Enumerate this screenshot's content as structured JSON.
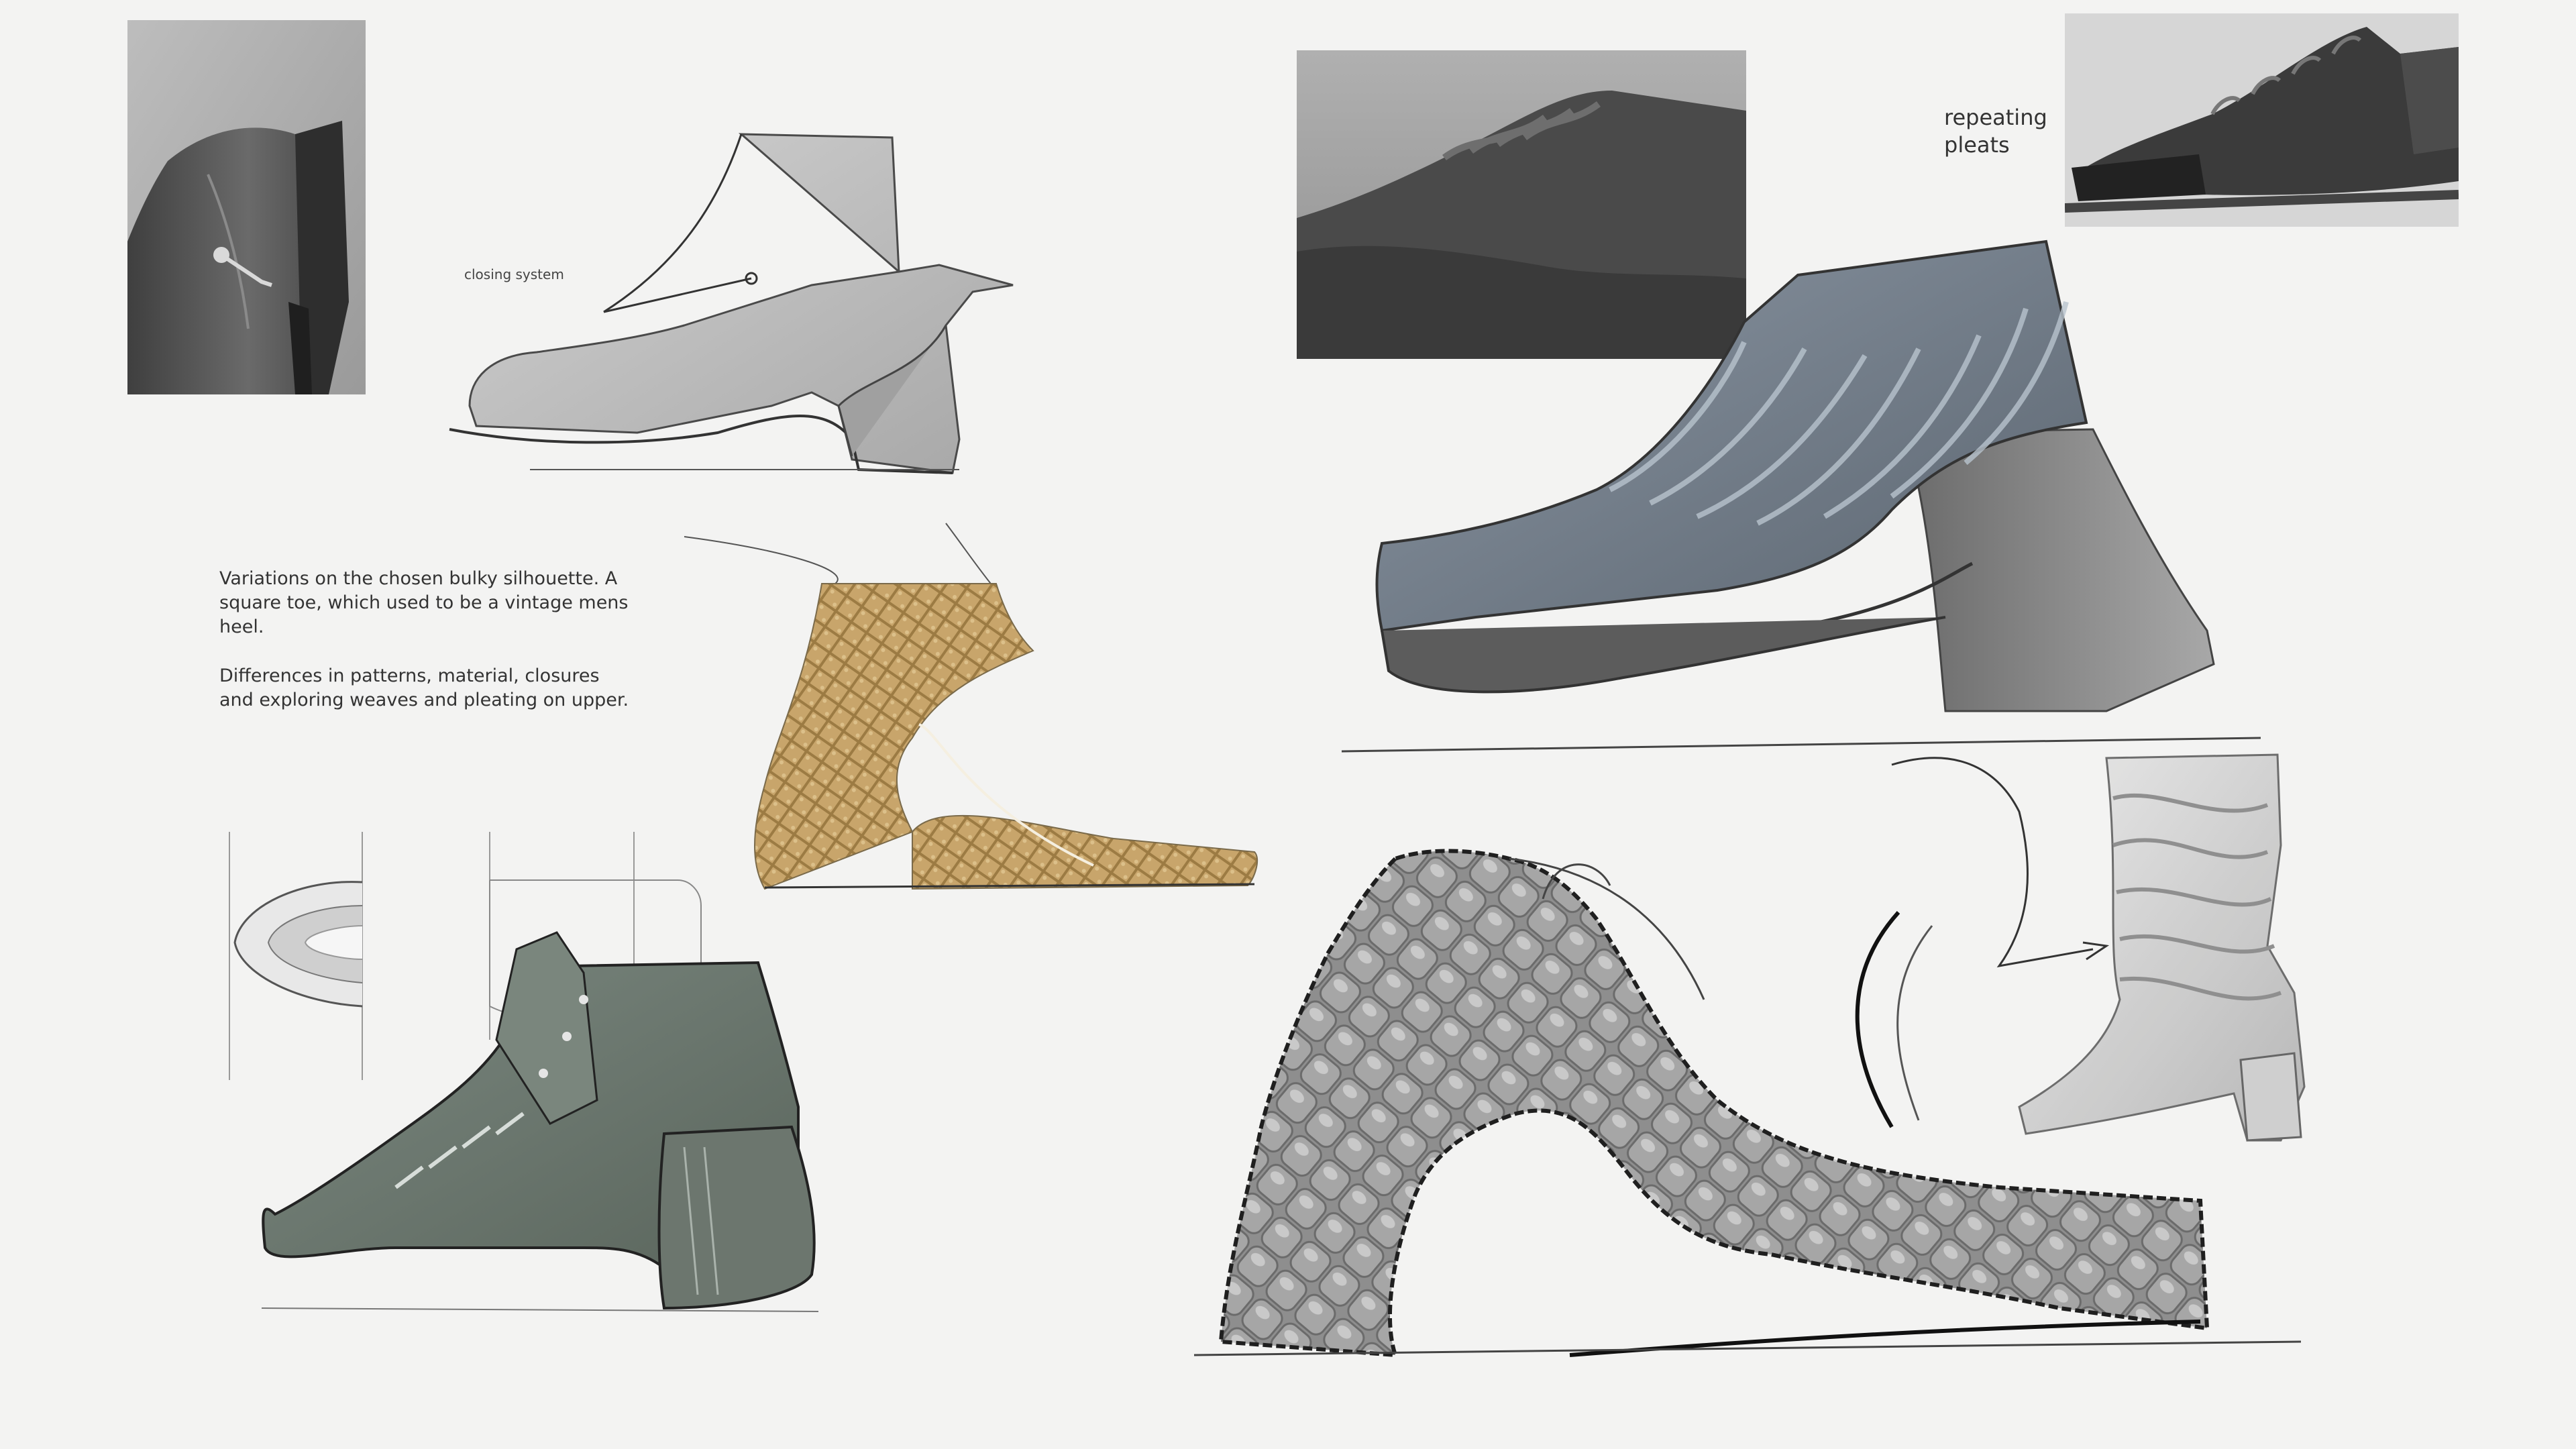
{
  "labels": {
    "closing_system": "closing system",
    "repeating_pleats": "repeating\npleats"
  },
  "notes": {
    "paragraph_1": "Variations on the chosen bulky silhouette. A\nsquare toe, which used to be a vintage mens\nheel.",
    "paragraph_2": "Differences in patterns, material, closures\nand exploring weaves and pleating on upper."
  },
  "colors": {
    "background": "#f3f3f2",
    "raffia": "#c8a56b",
    "green_leather": "#6f7a70",
    "slate_pleats": "#6f7884",
    "quilted_grey": "#8d8d8d"
  }
}
